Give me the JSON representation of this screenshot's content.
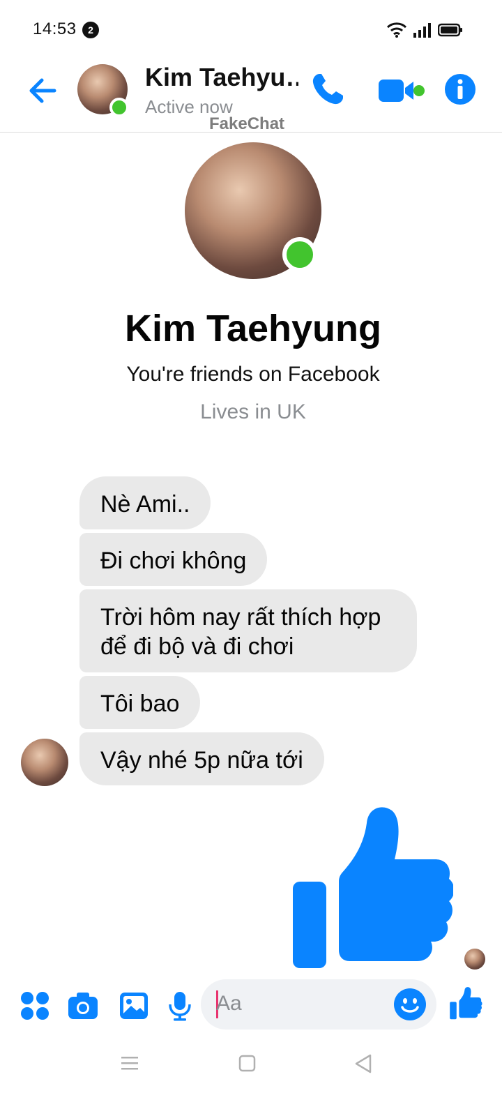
{
  "status_bar": {
    "time": "14:53",
    "notification_count": "2"
  },
  "header": {
    "contact_name": "Kim Taehyu…",
    "presence": "Active now",
    "watermark": "FakeChat"
  },
  "profile": {
    "name": "Kim Taehyung",
    "friends_text": "You're friends on Facebook",
    "lives_text": "Lives in UK"
  },
  "messages": [
    {
      "text": "Nè Ami.."
    },
    {
      "text": "Đi chơi không"
    },
    {
      "text": "Trời hôm nay rất thích hợp để đi bộ và đi chơi"
    },
    {
      "text": "Tôi bao"
    },
    {
      "text": "Vậy nhé 5p nữa tới"
    }
  ],
  "composer": {
    "placeholder": "Aa"
  },
  "colors": {
    "accent": "#0a84ff",
    "online": "#42c42e",
    "bubble": "#e9e9e9"
  },
  "icons": [
    "back-arrow-icon",
    "phone-icon",
    "video-camera-icon",
    "info-icon",
    "apps-icon",
    "camera-icon",
    "gallery-icon",
    "microphone-icon",
    "emoji-icon",
    "thumbs-up-icon",
    "menu-icon",
    "home-icon",
    "back-triangle-icon"
  ]
}
